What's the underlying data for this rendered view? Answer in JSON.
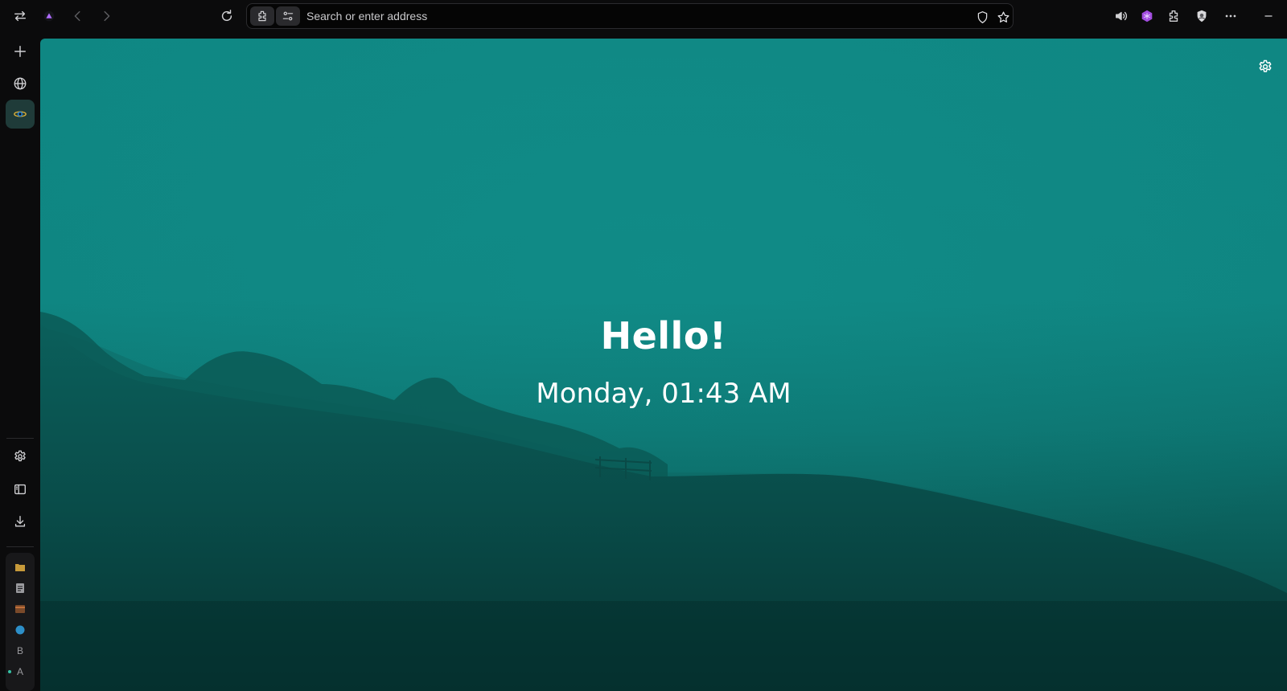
{
  "topbar": {
    "address_placeholder": "Search or enter address",
    "icons": [
      "tab-switch-icon",
      "browser-logo-icon",
      "back-icon",
      "forward-icon",
      "reload-icon",
      "extension-icon",
      "site-settings-icon",
      "shield-icon",
      "star-icon",
      "volume-icon",
      "purple-extension-icon",
      "extensions-puzzle-icon",
      "profile-shield-icon",
      "more-icon",
      "minimize-icon"
    ]
  },
  "sidebar": {
    "top_icons": [
      "plus-icon",
      "globe-icon",
      "active-app-icon"
    ],
    "bottom_icons": [
      "settings-icon",
      "sidebar-panel-icon",
      "download-icon"
    ],
    "pinned": [
      {
        "type": "folder-icon",
        "label": ""
      },
      {
        "type": "doc-icon",
        "label": ""
      },
      {
        "type": "box-icon",
        "label": ""
      },
      {
        "type": "globe-dot-icon",
        "label": ""
      },
      {
        "type": "letter",
        "label": "B"
      },
      {
        "type": "letter",
        "label": "A"
      }
    ]
  },
  "newtab": {
    "greeting": "Hello!",
    "datetime": "Monday, 01:43 AM"
  },
  "colors": {
    "chrome_bg": "#0b0b0c",
    "sky": "#0f8783",
    "hill_dark": "#083f3c",
    "text": "#ffffff",
    "accent_purple": "#a24de0"
  }
}
